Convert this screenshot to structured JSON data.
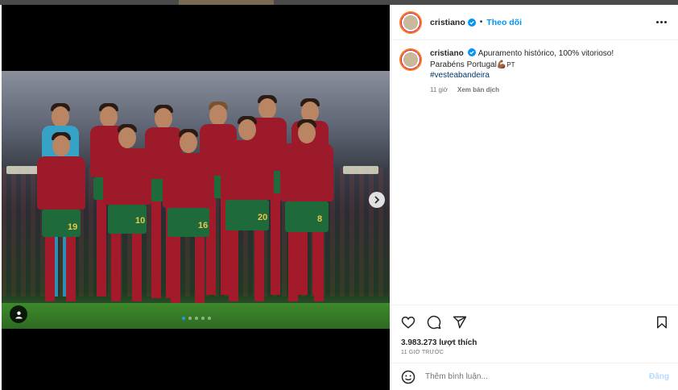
{
  "post": {
    "username": "cristiano",
    "separator": "•",
    "follow_label": "Theo dõi",
    "caption_line1": "Apuramento histórico, 100% vitorioso!",
    "caption_line2": "Parabéns Portugal💪🏾",
    "caption_flag": "PT",
    "hashtag": "#vesteabandeira",
    "caption_time": "11 giờ",
    "translate_label": "Xem bản dịch",
    "likes": "3.983.273 lượt thích",
    "time_ago": "11 GIỜ TRƯỚC",
    "comment_placeholder": "Thêm bình luận...",
    "post_button": "Đăng",
    "carousel": {
      "slide_count": 5,
      "active_index": 0
    }
  },
  "photo": {
    "jersey_numbers": [
      "10",
      "19",
      "16",
      "20",
      "8"
    ]
  },
  "colors": {
    "accent_blue": "#0095f6",
    "text": "#262626",
    "muted": "#737373",
    "hashtag": "#00376b",
    "jersey_red": "#9c1a2a",
    "shorts_green": "#1f6a3a"
  },
  "icons": {
    "verified": "verified-badge-icon",
    "more": "more-options-icon",
    "like": "heart-icon",
    "comment": "comment-icon",
    "share": "send-icon",
    "save": "bookmark-icon",
    "emoji": "emoji-icon",
    "next": "chevron-right-icon",
    "tags": "user-tag-icon"
  }
}
